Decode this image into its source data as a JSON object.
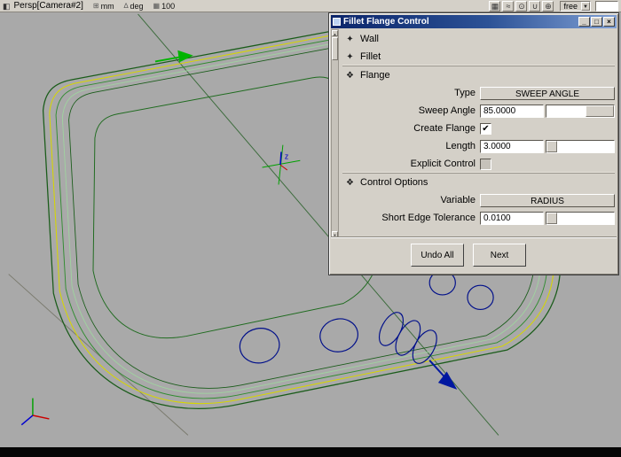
{
  "toolbar": {
    "view_label": "Persp[Camera#2]",
    "unit_mm": "mm",
    "unit_deg": "deg",
    "unit_scale": "100",
    "snap_mode": "free",
    "prompt_value": ""
  },
  "icons": {
    "camera_view": "◧",
    "linear_units": "⊞",
    "angular_units": "∆",
    "grid_size": "▦",
    "snap_grid": "▦",
    "snap_curve": "≈",
    "snap_point": "⊙",
    "magnet": "∪",
    "construction_plane": "⊕",
    "dropdown_arrow": "▼",
    "scroll_up": "▲",
    "scroll_down": "▼",
    "check": "✔"
  },
  "viewport": {
    "axis_z_label": "z"
  },
  "dialog": {
    "title": "Fillet Flange Control",
    "window_buttons": {
      "minimize": "_",
      "maximize": "□",
      "close": "×"
    },
    "sections": [
      {
        "label": "Wall",
        "state": "collapsed",
        "icon": "✦"
      },
      {
        "label": "Fillet",
        "state": "collapsed",
        "icon": "✦"
      },
      {
        "label": "Flange",
        "state": "expanded",
        "icon": "❖"
      },
      {
        "label": "Control Options",
        "state": "expanded",
        "icon": "❖"
      }
    ],
    "flange": {
      "type": {
        "label": "Type",
        "value": "SWEEP ANGLE"
      },
      "sweep_angle": {
        "label": "Sweep Angle",
        "value": "85.0000"
      },
      "create_flange": {
        "label": "Create Flange",
        "checked": true
      },
      "length": {
        "label": "Length",
        "value": "3.0000"
      },
      "explicit_control": {
        "label": "Explicit Control"
      }
    },
    "control_options": {
      "variable": {
        "label": "Variable",
        "value": "RADIUS"
      },
      "short_edge_tolerance": {
        "label": "Short Edge Tolerance",
        "value": "0.0100"
      }
    },
    "buttons": {
      "undo_all": "Undo All",
      "next": "Next"
    }
  },
  "colors": {
    "viewport_bg": "#a9a9a9",
    "panel_bg": "#d4d0c8",
    "titlebar_start": "#0a246a",
    "titlebar_end": "#7f9fd4",
    "curve_yellow": "#d6d600",
    "curve_green": "#2e8b2e",
    "curve_dark_green": "#1a5c1a",
    "curve_pale_green": "#9fd49f",
    "curve_navy": "#000f8a",
    "arrow_green": "#00b400",
    "arrow_blue": "#0018a0"
  }
}
